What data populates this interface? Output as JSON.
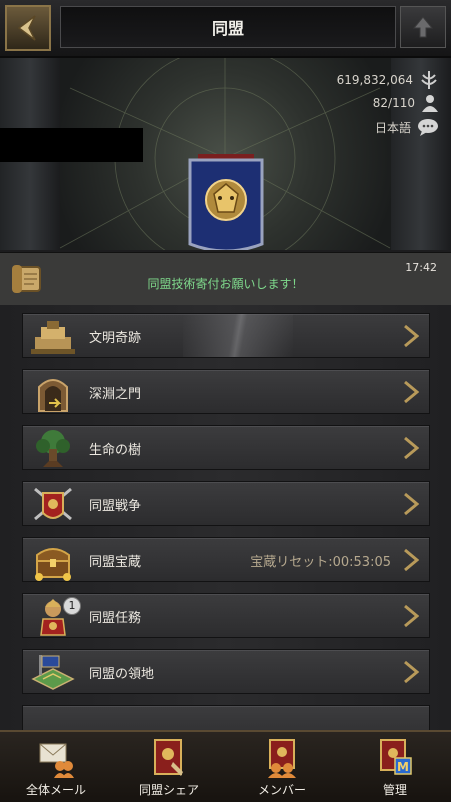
{
  "header": {
    "title": "同盟",
    "back_icon": "back-arrow-icon",
    "up_icon": "up-arrow-icon"
  },
  "alliance": {
    "power": "619,832,064",
    "members": "82/110",
    "language": "日本語"
  },
  "chat": {
    "time": "17:42",
    "message": "同盟技術寄付お願いします！"
  },
  "menu": {
    "items": [
      {
        "label": "文明奇跡",
        "note": "",
        "icon": "wonder-icon"
      },
      {
        "label": "深淵之門",
        "note": "",
        "icon": "abyss-gate-icon"
      },
      {
        "label": "生命の樹",
        "note": "",
        "icon": "tree-of-life-icon"
      },
      {
        "label": "同盟戦争",
        "note": "",
        "icon": "war-shield-icon"
      },
      {
        "label": "同盟宝蔵",
        "note": "宝蔵リセット:00:53:05",
        "icon": "treasure-chest-icon"
      },
      {
        "label": "同盟任務",
        "note": "",
        "icon": "quest-warrior-icon",
        "badge": "1"
      },
      {
        "label": "同盟の領地",
        "note": "",
        "icon": "territory-map-icon"
      }
    ]
  },
  "nav": {
    "items": [
      {
        "label": "全体メール",
        "icon": "mail-icon"
      },
      {
        "label": "同盟シェア",
        "icon": "share-icon"
      },
      {
        "label": "メンバー",
        "icon": "members-icon"
      },
      {
        "label": "管理",
        "icon": "manage-icon"
      }
    ]
  },
  "colors": {
    "chat_text": "#7fd98c",
    "accent_gold": "#b89a5a"
  }
}
